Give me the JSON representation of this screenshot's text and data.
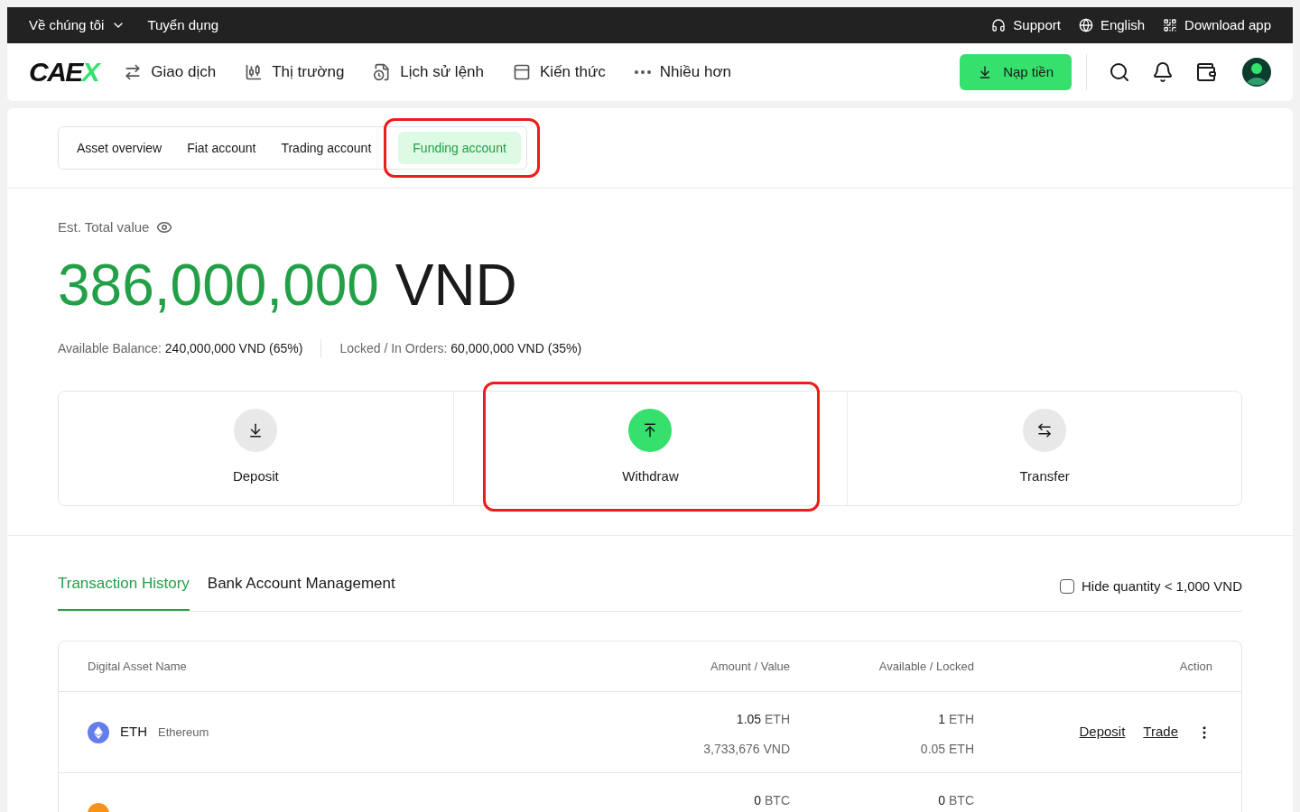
{
  "topbar": {
    "left": [
      {
        "label": "Về chúng tôi",
        "dropdown": true
      },
      {
        "label": "Tuyển dụng",
        "dropdown": false
      }
    ],
    "right": [
      {
        "kind": "support",
        "label": "Support"
      },
      {
        "kind": "language",
        "label": "English"
      },
      {
        "kind": "download",
        "label": "Download app"
      }
    ]
  },
  "nav": {
    "logo": {
      "text": "CAE",
      "accent": "X"
    },
    "items": [
      {
        "kind": "trade",
        "label": "Giao dịch"
      },
      {
        "kind": "market",
        "label": "Thị trường"
      },
      {
        "kind": "history",
        "label": "Lịch sử lệnh"
      },
      {
        "kind": "knowledge",
        "label": "Kiến thức"
      },
      {
        "kind": "more",
        "label": "Nhiều hơn"
      }
    ],
    "deposit_button": "Nạp tiền"
  },
  "account_tabs": [
    {
      "label": "Asset overview",
      "selected": false,
      "highlighted": false
    },
    {
      "label": "Fiat account",
      "selected": false,
      "highlighted": false
    },
    {
      "label": "Trading account",
      "selected": false,
      "highlighted": false
    },
    {
      "label": "Funding account",
      "selected": true,
      "highlighted": true
    }
  ],
  "total": {
    "label": "Est. Total value",
    "amount": "386,000,000",
    "currency": "VND"
  },
  "balances": [
    {
      "label": "Available Balance:",
      "value": "240,000,000 VND (65%)"
    },
    {
      "label": "Locked / In Orders:",
      "value": "60,000,000 VND (35%)"
    }
  ],
  "actions": [
    {
      "kind": "deposit",
      "label": "Deposit",
      "primary": false,
      "highlighted": false
    },
    {
      "kind": "withdraw",
      "label": "Withdraw",
      "primary": true,
      "highlighted": true
    },
    {
      "kind": "transfer",
      "label": "Transfer",
      "primary": false,
      "highlighted": false
    }
  ],
  "section_tabs": [
    {
      "label": "Transaction History",
      "selected": true
    },
    {
      "label": "Bank Account Management",
      "selected": false
    }
  ],
  "hide_small": {
    "label": "Hide quantity < 1,000 VND",
    "checked": false
  },
  "table": {
    "columns": [
      "Digital Asset Name",
      "Amount / Value",
      "Available / Locked",
      "Action"
    ],
    "rows": [
      {
        "symbol": "ETH",
        "name": "Ethereum",
        "color": "#627eea",
        "amount": "1.05",
        "unit": "ETH",
        "value": "3,733,676 VND",
        "available": "1",
        "available_unit": "ETH",
        "locked": "0.05 ETH",
        "links": [
          "Deposit",
          "Trade"
        ]
      },
      {
        "color": "#f7931a",
        "amount": "0",
        "unit": "BTC",
        "available": "0",
        "available_unit": "BTC"
      }
    ]
  }
}
